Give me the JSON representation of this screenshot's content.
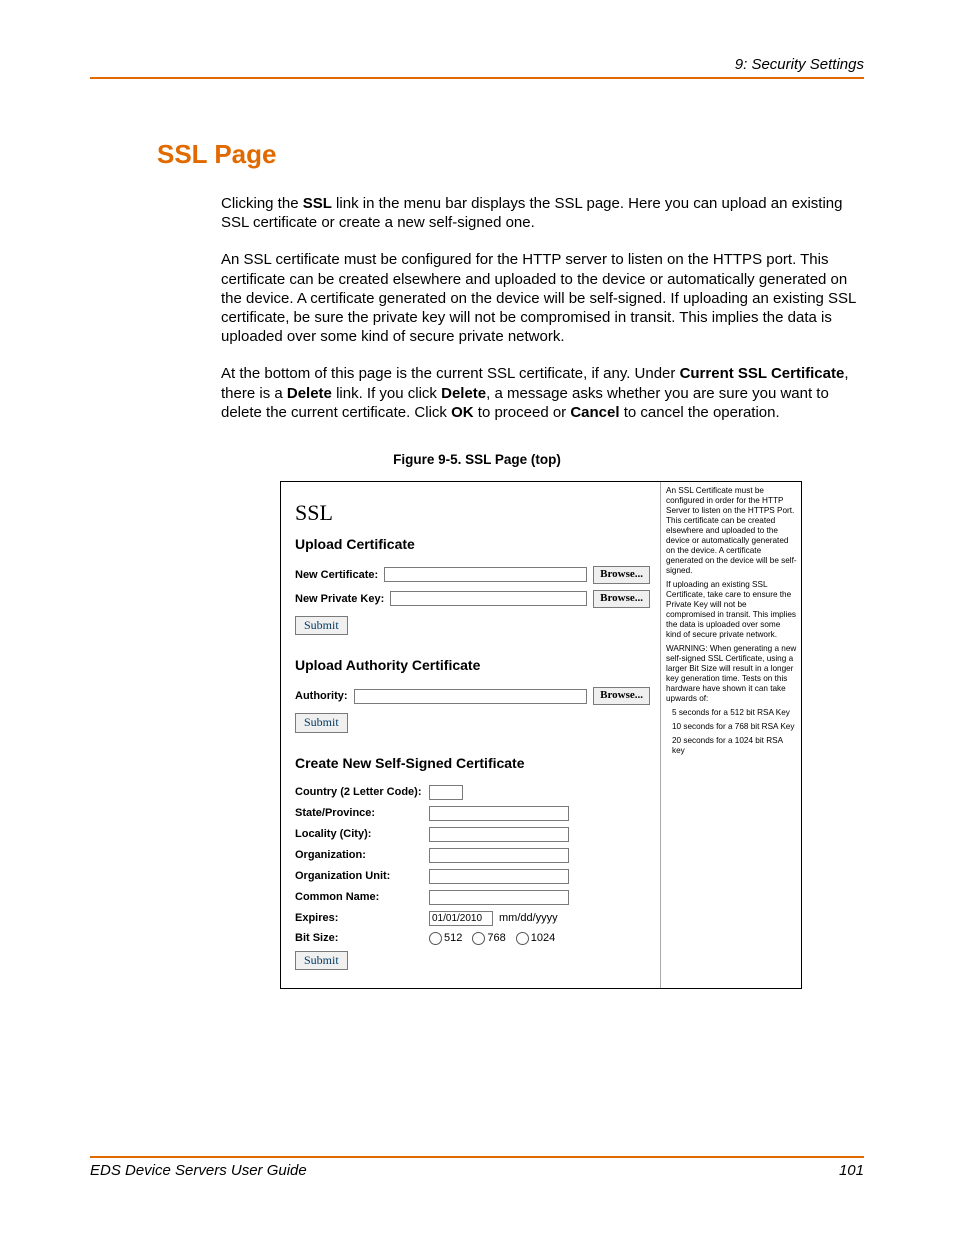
{
  "header": {
    "right": "9: Security Settings"
  },
  "h1": "SSL Page",
  "paragraphs": {
    "p1_a": "Clicking the ",
    "p1_b": "SSL",
    "p1_c": " link in the menu bar displays the SSL page. Here you can upload an existing SSL certificate or create a new self-signed one.",
    "p2": "An SSL certificate must be configured for the HTTP server to listen on the HTTPS port. This certificate can be created elsewhere and uploaded to the device or automatically generated on the device. A certificate generated on the device will be self-signed. If uploading an existing SSL certificate, be sure the private key will not be compromised in transit. This implies the data is uploaded over some kind of secure private network.",
    "p3_a": "At the bottom of this page is the current SSL certificate, if any. Under ",
    "p3_b": "Current SSL Certificate",
    "p3_c": ", there is a ",
    "p3_d": "Delete",
    "p3_e": " link. If you click ",
    "p3_f": "Delete",
    "p3_g": ", a message asks whether you are sure you want to delete the current certificate. Click ",
    "p3_h": "OK",
    "p3_i": " to proceed or ",
    "p3_j": "Cancel",
    "p3_k": " to cancel the operation."
  },
  "figure_caption": "Figure 9-5. SSL Page (top)",
  "shot": {
    "title": "SSL",
    "sec1": "Upload Certificate",
    "new_cert_label": "New Certificate:",
    "new_key_label": "New Private Key:",
    "browse": "Browse...",
    "submit": "Submit",
    "sec2": "Upload Authority Certificate",
    "authority_label": "Authority:",
    "sec3": "Create New Self-Signed Certificate",
    "f_country": "Country (2 Letter Code):",
    "f_state": "State/Province:",
    "f_locality": "Locality (City):",
    "f_org": "Organization:",
    "f_orgunit": "Organization Unit:",
    "f_cn": "Common Name:",
    "f_expires": "Expires:",
    "f_expires_val": "01/01/2010",
    "f_expires_hint": "mm/dd/yyyy",
    "f_bits": "Bit Size:",
    "bit512": "512",
    "bit768": "768",
    "bit1024": "1024",
    "help1": "An SSL Certificate must be configured in order for the HTTP Server to listen on the HTTPS Port. This certificate can be created elsewhere and uploaded to the device or automatically generated on the device. A certificate generated on the device will be self-signed.",
    "help2": "If uploading an existing SSL Certificate, take care to ensure the Private Key will not be compromised in transit. This implies the data is uploaded over some kind of secure private network.",
    "help3": "WARNING: When generating a new self-signed SSL Certificate, using a larger Bit Size will result in a longer key generation time. Tests on this hardware have shown it can take upwards of:",
    "help4a": "5 seconds for a 512 bit RSA Key",
    "help4b": "10 seconds for a 768 bit RSA Key",
    "help4c": "20 seconds for a 1024 bit RSA key"
  },
  "footer": {
    "left": "EDS Device Servers User Guide",
    "right": "101"
  }
}
